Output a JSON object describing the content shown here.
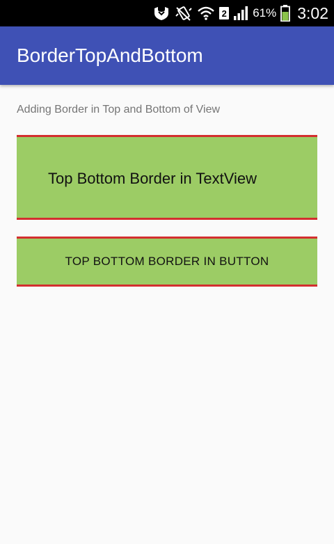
{
  "status_bar": {
    "sim_slot": "2",
    "battery_percent": "61%",
    "time": "3:02",
    "icons": [
      "security-shield-icon",
      "vibrate-icon",
      "wifi-icon",
      "sim-badge",
      "signal-icon",
      "battery-icon"
    ]
  },
  "app_bar": {
    "title": "BorderTopAndBottom",
    "background": "#3f51b5"
  },
  "content": {
    "subtitle": "Adding Border in Top and Bottom of View",
    "text_view_label": "Top Bottom Border in TextView",
    "button_label": "TOP BOTTOM BORDER IN BUTTON"
  },
  "colors": {
    "border": "#d32f2f",
    "fill": "#9ccc65",
    "page_bg": "#fafafa"
  }
}
